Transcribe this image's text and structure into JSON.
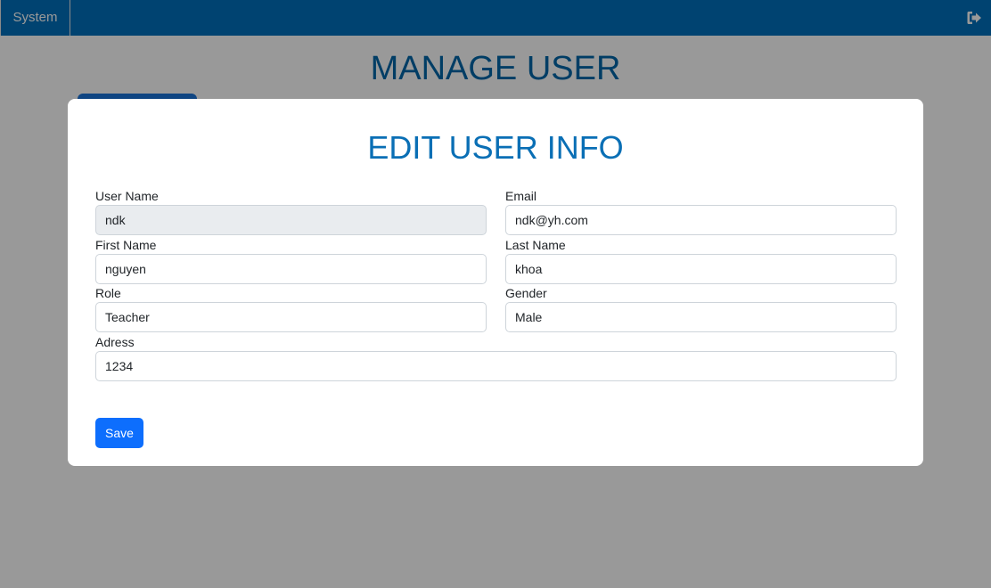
{
  "nav": {
    "system_label": "System",
    "logout_icon": "sign-out-icon"
  },
  "page": {
    "title": "MANAGE USER"
  },
  "modal": {
    "title": "EDIT USER INFO",
    "fields": {
      "user_name": {
        "label": "User Name",
        "value": "ndk",
        "disabled": true
      },
      "email": {
        "label": "Email",
        "value": "ndk@yh.com"
      },
      "first_name": {
        "label": "First Name",
        "value": "nguyen"
      },
      "last_name": {
        "label": "Last Name",
        "value": "khoa"
      },
      "role": {
        "label": "Role",
        "value": "Teacher"
      },
      "gender": {
        "label": "Gender",
        "value": "Male"
      },
      "address": {
        "label": "Adress",
        "value": "1234"
      }
    },
    "save_label": "Save"
  },
  "colors": {
    "topbar": "#0071bc",
    "title": "#0066a8",
    "modal_title": "#0a6fb5",
    "primary_button": "#0d6efd",
    "overlay": "rgba(0,0,0,0.4)"
  }
}
